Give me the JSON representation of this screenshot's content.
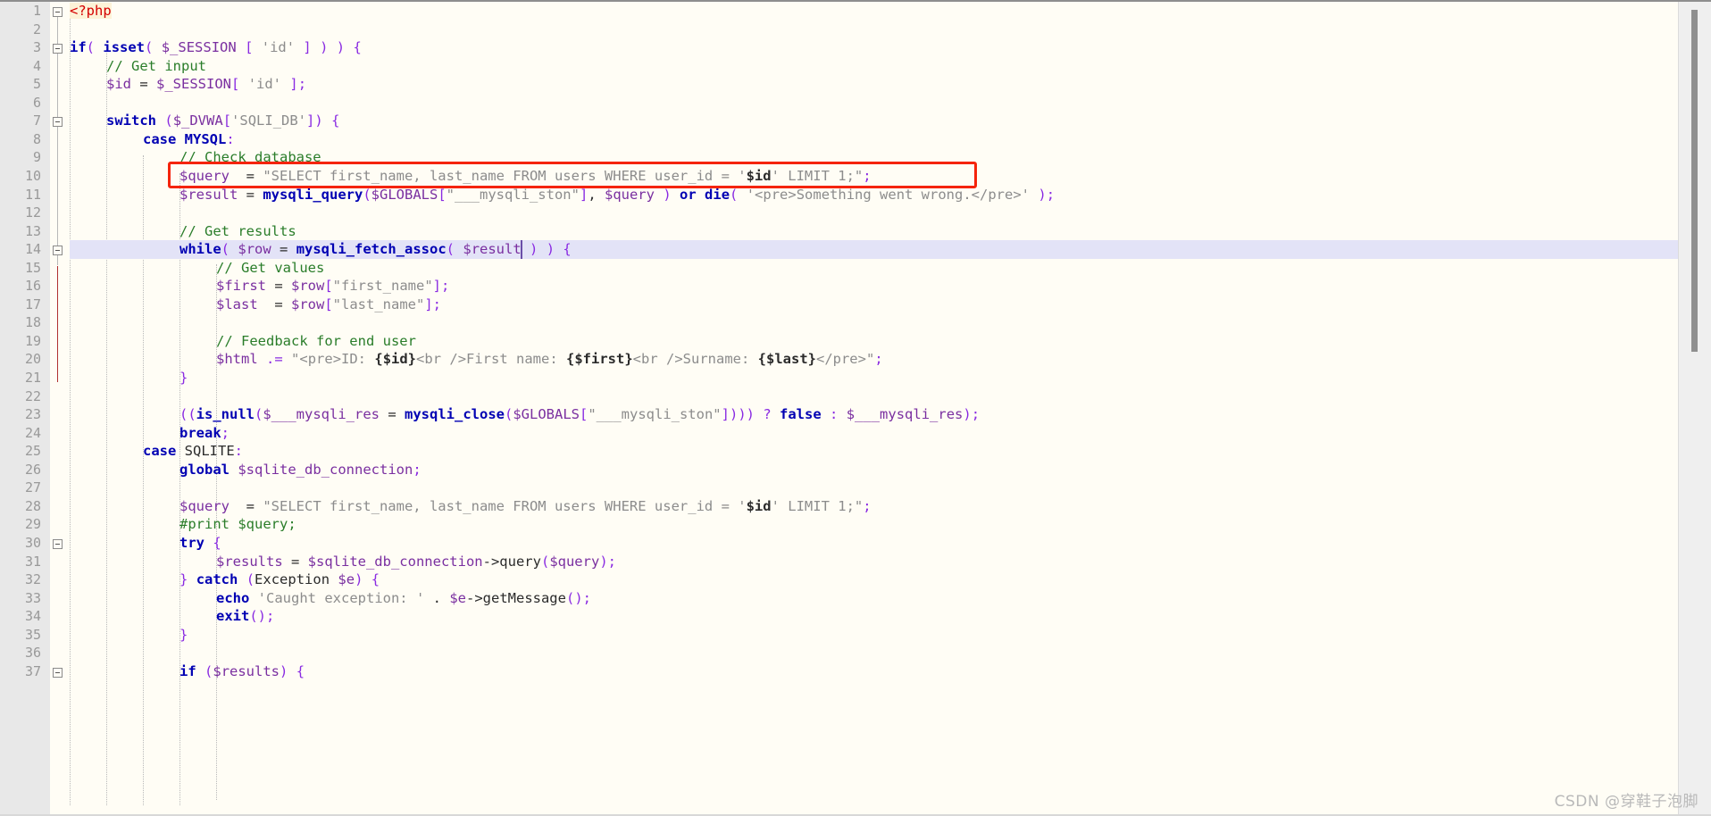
{
  "editor": {
    "language": "PHP",
    "file_kind": "php-source",
    "highlighted_line": 14,
    "caret_line": 14,
    "caret_column_text": "$re|sult",
    "annotation": {
      "type": "rectangle",
      "color": "#f5240c",
      "targets_line": 10
    },
    "colors": {
      "background": "#fffdf5",
      "gutter": "#e8e8e8",
      "line_number": "#999999",
      "highlight_line": "#e3e3f7",
      "keyword": "#0000b3",
      "variable": "#7a2fa0",
      "string": "#8c8c8c",
      "comment": "#2a7d2a",
      "punctuation": "#8a2be2",
      "number": "#1750eb",
      "php_tag": "#d40000",
      "annotation_red": "#f5240c",
      "scrollbar_thumb": "#8f8f8f"
    }
  },
  "line_numbers": [
    1,
    2,
    3,
    4,
    5,
    6,
    7,
    8,
    9,
    10,
    11,
    12,
    13,
    14,
    15,
    16,
    17,
    18,
    19,
    20,
    21,
    22,
    23,
    24,
    25,
    26,
    27,
    28,
    29,
    30,
    31,
    32,
    33,
    34,
    35,
    36,
    37
  ],
  "code_lines": [
    {
      "n": 1,
      "indent": 0,
      "tokens": [
        {
          "t": "<?php",
          "c": "tagbg"
        }
      ]
    },
    {
      "n": 2,
      "indent": 0,
      "tokens": []
    },
    {
      "n": 3,
      "indent": 0,
      "tokens": [
        {
          "t": "if",
          "c": "kw"
        },
        {
          "t": "(",
          "c": "pun"
        },
        {
          "t": " ",
          "c": "plain"
        },
        {
          "t": "isset",
          "c": "fn"
        },
        {
          "t": "(",
          "c": "pun"
        },
        {
          "t": " ",
          "c": "plain"
        },
        {
          "t": "$_SESSION",
          "c": "var"
        },
        {
          "t": " ",
          "c": "plain"
        },
        {
          "t": "[",
          "c": "pun"
        },
        {
          "t": " ",
          "c": "plain"
        },
        {
          "t": "'id'",
          "c": "str"
        },
        {
          "t": " ",
          "c": "plain"
        },
        {
          "t": "]",
          "c": "pun"
        },
        {
          "t": " ",
          "c": "plain"
        },
        {
          "t": ")",
          "c": "pun"
        },
        {
          "t": " ",
          "c": "plain"
        },
        {
          "t": ")",
          "c": "pun"
        },
        {
          "t": " ",
          "c": "plain"
        },
        {
          "t": "{",
          "c": "pun"
        }
      ]
    },
    {
      "n": 4,
      "indent": 1,
      "tokens": [
        {
          "t": "// Get input",
          "c": "cmt"
        }
      ]
    },
    {
      "n": 5,
      "indent": 1,
      "tokens": [
        {
          "t": "$id",
          "c": "var"
        },
        {
          "t": " = ",
          "c": "plain"
        },
        {
          "t": "$_SESSION",
          "c": "var"
        },
        {
          "t": "[",
          "c": "pun"
        },
        {
          "t": " ",
          "c": "plain"
        },
        {
          "t": "'id'",
          "c": "str"
        },
        {
          "t": " ",
          "c": "plain"
        },
        {
          "t": "]",
          "c": "pun"
        },
        {
          "t": ";",
          "c": "pun"
        }
      ]
    },
    {
      "n": 6,
      "indent": 1,
      "tokens": []
    },
    {
      "n": 7,
      "indent": 1,
      "tokens": [
        {
          "t": "switch",
          "c": "kw"
        },
        {
          "t": " ",
          "c": "plain"
        },
        {
          "t": "(",
          "c": "pun"
        },
        {
          "t": "$_DVWA",
          "c": "var"
        },
        {
          "t": "[",
          "c": "pun"
        },
        {
          "t": "'SQLI_DB'",
          "c": "str"
        },
        {
          "t": "]",
          "c": "pun"
        },
        {
          "t": ")",
          "c": "pun"
        },
        {
          "t": " ",
          "c": "plain"
        },
        {
          "t": "{",
          "c": "pun"
        }
      ]
    },
    {
      "n": 8,
      "indent": 2,
      "tokens": [
        {
          "t": "case",
          "c": "kw"
        },
        {
          "t": " ",
          "c": "plain"
        },
        {
          "t": "MYSQL",
          "c": "const"
        },
        {
          "t": ":",
          "c": "pun"
        }
      ]
    },
    {
      "n": 9,
      "indent": 3,
      "tokens": [
        {
          "t": "// Check database",
          "c": "cmt"
        }
      ]
    },
    {
      "n": 10,
      "indent": 3,
      "tokens": [
        {
          "t": "$query",
          "c": "var"
        },
        {
          "t": "  = ",
          "c": "plain"
        },
        {
          "t": "\"SELECT first_name, last_name FROM users WHERE user_id = '",
          "c": "str"
        },
        {
          "t": "$id",
          "c": "interp"
        },
        {
          "t": "' LIMIT 1;\"",
          "c": "str"
        },
        {
          "t": ";",
          "c": "pun"
        }
      ]
    },
    {
      "n": 11,
      "indent": 3,
      "tokens": [
        {
          "t": "$result",
          "c": "var"
        },
        {
          "t": " = ",
          "c": "plain"
        },
        {
          "t": "mysqli_query",
          "c": "fn"
        },
        {
          "t": "(",
          "c": "pun"
        },
        {
          "t": "$GLOBALS",
          "c": "var"
        },
        {
          "t": "[",
          "c": "pun"
        },
        {
          "t": "\"___mysqli_ston\"",
          "c": "str"
        },
        {
          "t": "]",
          "c": "pun"
        },
        {
          "t": ", ",
          "c": "plain"
        },
        {
          "t": "$query",
          "c": "var"
        },
        {
          "t": " ",
          "c": "plain"
        },
        {
          "t": ")",
          "c": "pun"
        },
        {
          "t": " ",
          "c": "plain"
        },
        {
          "t": "or",
          "c": "kw"
        },
        {
          "t": " ",
          "c": "plain"
        },
        {
          "t": "die",
          "c": "kw"
        },
        {
          "t": "(",
          "c": "pun"
        },
        {
          "t": " ",
          "c": "plain"
        },
        {
          "t": "'<pre>Something went wrong.</pre>'",
          "c": "str"
        },
        {
          "t": " ",
          "c": "plain"
        },
        {
          "t": ")",
          "c": "pun"
        },
        {
          "t": ";",
          "c": "pun"
        }
      ]
    },
    {
      "n": 12,
      "indent": 3,
      "tokens": []
    },
    {
      "n": 13,
      "indent": 3,
      "tokens": [
        {
          "t": "// Get results",
          "c": "cmt"
        }
      ]
    },
    {
      "n": 14,
      "indent": 3,
      "tokens": [
        {
          "t": "while",
          "c": "kw"
        },
        {
          "t": "(",
          "c": "pun"
        },
        {
          "t": " ",
          "c": "plain"
        },
        {
          "t": "$row",
          "c": "var"
        },
        {
          "t": " = ",
          "c": "plain"
        },
        {
          "t": "mysqli_fetch_assoc",
          "c": "fn"
        },
        {
          "t": "(",
          "c": "pun"
        },
        {
          "t": " ",
          "c": "plain"
        },
        {
          "t": "$result",
          "c": "var"
        },
        {
          "t": " ",
          "c": "plain"
        },
        {
          "t": ")",
          "c": "pun"
        },
        {
          "t": " ",
          "c": "plain"
        },
        {
          "t": ")",
          "c": "pun"
        },
        {
          "t": " ",
          "c": "plain"
        },
        {
          "t": "{",
          "c": "pun"
        }
      ]
    },
    {
      "n": 15,
      "indent": 4,
      "tokens": [
        {
          "t": "// Get values",
          "c": "cmt"
        }
      ]
    },
    {
      "n": 16,
      "indent": 4,
      "tokens": [
        {
          "t": "$first",
          "c": "var"
        },
        {
          "t": " = ",
          "c": "plain"
        },
        {
          "t": "$row",
          "c": "var"
        },
        {
          "t": "[",
          "c": "pun"
        },
        {
          "t": "\"first_name\"",
          "c": "str"
        },
        {
          "t": "]",
          "c": "pun"
        },
        {
          "t": ";",
          "c": "pun"
        }
      ]
    },
    {
      "n": 17,
      "indent": 4,
      "tokens": [
        {
          "t": "$last",
          "c": "var"
        },
        {
          "t": "  = ",
          "c": "plain"
        },
        {
          "t": "$row",
          "c": "var"
        },
        {
          "t": "[",
          "c": "pun"
        },
        {
          "t": "\"last_name\"",
          "c": "str"
        },
        {
          "t": "]",
          "c": "pun"
        },
        {
          "t": ";",
          "c": "pun"
        }
      ]
    },
    {
      "n": 18,
      "indent": 4,
      "tokens": []
    },
    {
      "n": 19,
      "indent": 4,
      "tokens": [
        {
          "t": "// Feedback for end user",
          "c": "cmt"
        }
      ]
    },
    {
      "n": 20,
      "indent": 4,
      "tokens": [
        {
          "t": "$html",
          "c": "var"
        },
        {
          "t": " ",
          "c": "plain"
        },
        {
          "t": ".=",
          "c": "pun"
        },
        {
          "t": " ",
          "c": "plain"
        },
        {
          "t": "\"<pre>ID: ",
          "c": "str"
        },
        {
          "t": "{$id}",
          "c": "interp"
        },
        {
          "t": "<br />First name: ",
          "c": "str"
        },
        {
          "t": "{$first}",
          "c": "interp"
        },
        {
          "t": "<br />Surname: ",
          "c": "str"
        },
        {
          "t": "{$last}",
          "c": "interp"
        },
        {
          "t": "</pre>\"",
          "c": "str"
        },
        {
          "t": ";",
          "c": "pun"
        }
      ]
    },
    {
      "n": 21,
      "indent": 3,
      "tokens": [
        {
          "t": "}",
          "c": "pun"
        }
      ]
    },
    {
      "n": 22,
      "indent": 3,
      "tokens": []
    },
    {
      "n": 23,
      "indent": 3,
      "tokens": [
        {
          "t": "((",
          "c": "pun"
        },
        {
          "t": "is_null",
          "c": "fn"
        },
        {
          "t": "(",
          "c": "pun"
        },
        {
          "t": "$___mysqli_res",
          "c": "var"
        },
        {
          "t": " = ",
          "c": "plain"
        },
        {
          "t": "mysqli_close",
          "c": "fn"
        },
        {
          "t": "(",
          "c": "pun"
        },
        {
          "t": "$GLOBALS",
          "c": "var"
        },
        {
          "t": "[",
          "c": "pun"
        },
        {
          "t": "\"___mysqli_ston\"",
          "c": "str"
        },
        {
          "t": "]",
          "c": "pun"
        },
        {
          "t": ")))",
          "c": "pun"
        },
        {
          "t": " ",
          "c": "plain"
        },
        {
          "t": "?",
          "c": "pun"
        },
        {
          "t": " ",
          "c": "plain"
        },
        {
          "t": "false",
          "c": "kw"
        },
        {
          "t": " ",
          "c": "plain"
        },
        {
          "t": ":",
          "c": "pun"
        },
        {
          "t": " ",
          "c": "plain"
        },
        {
          "t": "$___mysqli_res",
          "c": "var"
        },
        {
          "t": ")",
          "c": "pun"
        },
        {
          "t": ";",
          "c": "pun"
        }
      ]
    },
    {
      "n": 24,
      "indent": 3,
      "tokens": [
        {
          "t": "break",
          "c": "kw"
        },
        {
          "t": ";",
          "c": "pun"
        }
      ]
    },
    {
      "n": 25,
      "indent": 2,
      "tokens": [
        {
          "t": "case",
          "c": "kw"
        },
        {
          "t": " ",
          "c": "plain"
        },
        {
          "t": "SQLITE",
          "c": "plain"
        },
        {
          "t": ":",
          "c": "pun"
        }
      ]
    },
    {
      "n": 26,
      "indent": 3,
      "tokens": [
        {
          "t": "global",
          "c": "kw"
        },
        {
          "t": " ",
          "c": "plain"
        },
        {
          "t": "$sqlite_db_connection",
          "c": "var"
        },
        {
          "t": ";",
          "c": "pun"
        }
      ]
    },
    {
      "n": 27,
      "indent": 3,
      "tokens": []
    },
    {
      "n": 28,
      "indent": 3,
      "tokens": [
        {
          "t": "$query",
          "c": "var"
        },
        {
          "t": "  = ",
          "c": "plain"
        },
        {
          "t": "\"SELECT first_name, last_name FROM users WHERE user_id = '",
          "c": "str"
        },
        {
          "t": "$id",
          "c": "interp"
        },
        {
          "t": "' LIMIT 1;\"",
          "c": "str"
        },
        {
          "t": ";",
          "c": "pun"
        }
      ]
    },
    {
      "n": 29,
      "indent": 3,
      "tokens": [
        {
          "t": "#print $query;",
          "c": "cmt"
        }
      ]
    },
    {
      "n": 30,
      "indent": 3,
      "tokens": [
        {
          "t": "try",
          "c": "kw"
        },
        {
          "t": " ",
          "c": "plain"
        },
        {
          "t": "{",
          "c": "pun"
        }
      ]
    },
    {
      "n": 31,
      "indent": 4,
      "tokens": [
        {
          "t": "$results",
          "c": "var"
        },
        {
          "t": " = ",
          "c": "plain"
        },
        {
          "t": "$sqlite_db_connection",
          "c": "var"
        },
        {
          "t": "->",
          "c": "plain"
        },
        {
          "t": "query",
          "c": "plain"
        },
        {
          "t": "(",
          "c": "pun"
        },
        {
          "t": "$query",
          "c": "var"
        },
        {
          "t": ")",
          "c": "pun"
        },
        {
          "t": ";",
          "c": "pun"
        }
      ]
    },
    {
      "n": 32,
      "indent": 3,
      "tokens": [
        {
          "t": "}",
          "c": "pun"
        },
        {
          "t": " ",
          "c": "plain"
        },
        {
          "t": "catch",
          "c": "kw"
        },
        {
          "t": " ",
          "c": "plain"
        },
        {
          "t": "(",
          "c": "pun"
        },
        {
          "t": "Exception",
          "c": "plain"
        },
        {
          "t": " ",
          "c": "plain"
        },
        {
          "t": "$e",
          "c": "var"
        },
        {
          "t": ")",
          "c": "pun"
        },
        {
          "t": " ",
          "c": "plain"
        },
        {
          "t": "{",
          "c": "pun"
        }
      ]
    },
    {
      "n": 33,
      "indent": 4,
      "tokens": [
        {
          "t": "echo",
          "c": "kw"
        },
        {
          "t": " ",
          "c": "plain"
        },
        {
          "t": "'Caught exception: '",
          "c": "str"
        },
        {
          "t": " . ",
          "c": "plain"
        },
        {
          "t": "$e",
          "c": "var"
        },
        {
          "t": "->",
          "c": "plain"
        },
        {
          "t": "getMessage",
          "c": "plain"
        },
        {
          "t": "(",
          "c": "pun"
        },
        {
          "t": ")",
          "c": "pun"
        },
        {
          "t": ";",
          "c": "pun"
        }
      ]
    },
    {
      "n": 34,
      "indent": 4,
      "tokens": [
        {
          "t": "exit",
          "c": "kw"
        },
        {
          "t": "(",
          "c": "pun"
        },
        {
          "t": ")",
          "c": "pun"
        },
        {
          "t": ";",
          "c": "pun"
        }
      ]
    },
    {
      "n": 35,
      "indent": 3,
      "tokens": [
        {
          "t": "}",
          "c": "pun"
        }
      ]
    },
    {
      "n": 36,
      "indent": 3,
      "tokens": []
    },
    {
      "n": 37,
      "indent": 3,
      "tokens": [
        {
          "t": "if",
          "c": "kw"
        },
        {
          "t": " ",
          "c": "plain"
        },
        {
          "t": "(",
          "c": "pun"
        },
        {
          "t": "$results",
          "c": "var"
        },
        {
          "t": ")",
          "c": "pun"
        },
        {
          "t": " ",
          "c": "plain"
        },
        {
          "t": "{",
          "c": "pun"
        }
      ]
    }
  ],
  "fold_markers": [
    {
      "line": 1,
      "kind": "collapse"
    },
    {
      "line": 3,
      "kind": "collapse"
    },
    {
      "line": 7,
      "kind": "collapse"
    },
    {
      "line": 14,
      "kind": "collapse"
    },
    {
      "line": 30,
      "kind": "collapse"
    },
    {
      "line": 37,
      "kind": "collapse"
    }
  ],
  "watermark": {
    "text": "CSDN @穿鞋子泡脚"
  },
  "scrollbar": {
    "orientation": "vertical",
    "thumb_top_pct": 1,
    "thumb_height_pct": 42
  }
}
